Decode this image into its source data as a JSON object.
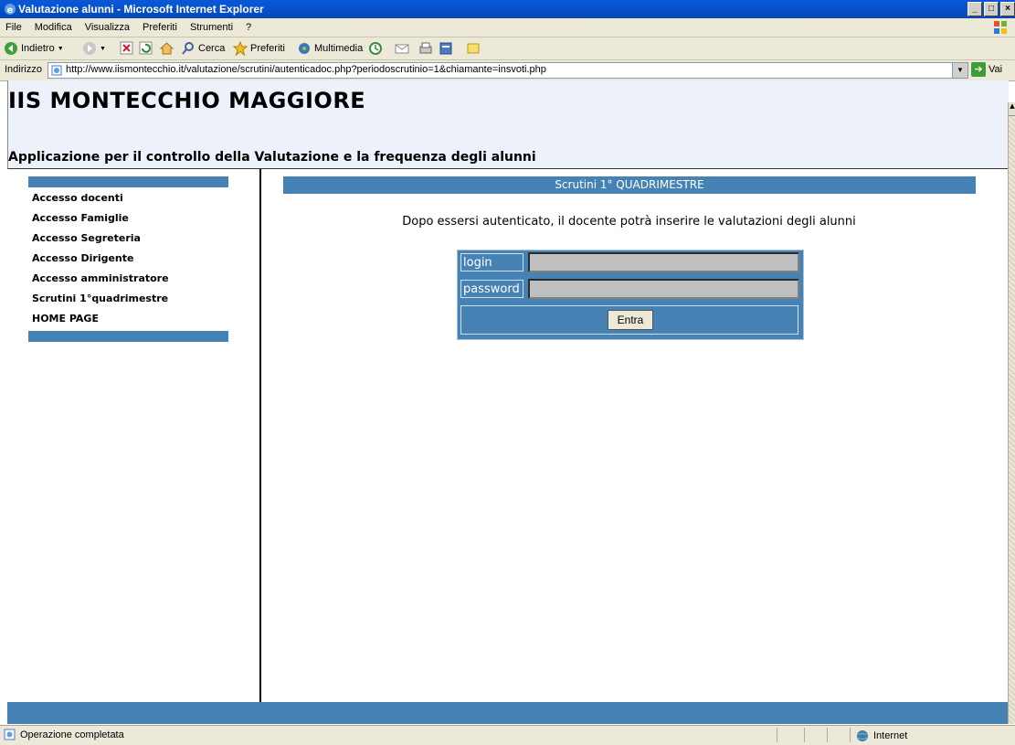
{
  "window": {
    "title": "Valutazione alunni - Microsoft Internet Explorer",
    "controls": [
      "_",
      "□",
      "×"
    ]
  },
  "menu": [
    "File",
    "Modifica",
    "Visualizza",
    "Preferiti",
    "Strumenti",
    "?"
  ],
  "toolbar": {
    "back": "Indietro",
    "search": "Cerca",
    "favorites": "Preferiti",
    "media": "Multimedia"
  },
  "address": {
    "label": "Indirizzo",
    "url": "http://www.iismontecchio.it/valutazione/scrutini/autenticadoc.php?periodoscrutinio=1&chiamante=insvoti.php",
    "go": "Vai"
  },
  "page": {
    "title": "IIS MONTECCHIO MAGGIORE",
    "subtitle": "Applicazione per il controllo della Valutazione e la frequenza degli alunni"
  },
  "sidebar": {
    "items": [
      "Accesso docenti",
      "Accesso Famiglie",
      "Accesso Segreteria",
      "Accesso Dirigente",
      "Accesso amministratore",
      "Scrutini 1°quadrimestre",
      "HOME PAGE"
    ]
  },
  "content": {
    "section_title": "Scrutini 1° QUADRIMESTRE",
    "info": "Dopo essersi autenticato, il docente potrà inserire le valutazioni degli alunni",
    "login_label": "login",
    "password_label": "password",
    "login_value": "",
    "password_value": "",
    "submit": "Entra"
  },
  "status": {
    "text": "Operazione completata",
    "zone": "Internet"
  },
  "colors": {
    "accent": "#4682b4",
    "header_bg": "#edf2fa",
    "chrome": "#ece9d8"
  }
}
